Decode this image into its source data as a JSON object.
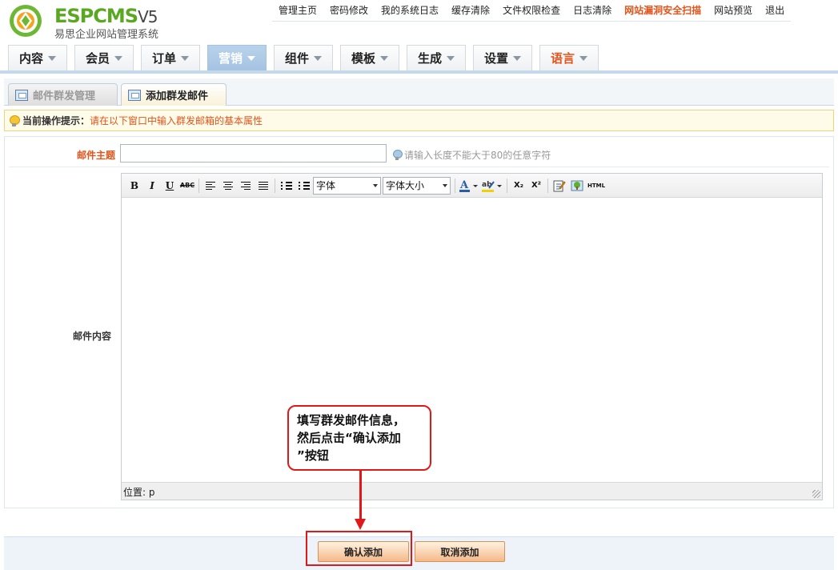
{
  "logo": {
    "brand_espcms": "ESPCMS",
    "brand_version": "V5",
    "subtitle": "易思企业网站管理系统"
  },
  "top_nav": [
    "管理主页",
    "密码修改",
    "我的系统日志",
    "缓存清除",
    "文件权限检查",
    "日志清除",
    "网站漏洞安全扫描",
    "网站预览",
    "退出"
  ],
  "main_menu": [
    {
      "label": "内容"
    },
    {
      "label": "会员"
    },
    {
      "label": "订单"
    },
    {
      "label": "营销"
    },
    {
      "label": "组件"
    },
    {
      "label": "模板"
    },
    {
      "label": "生成"
    },
    {
      "label": "设置"
    },
    {
      "label": "语言"
    }
  ],
  "active_menu": "营销",
  "tabs": [
    {
      "label": "邮件群发管理"
    },
    {
      "label": "添加群发邮件"
    }
  ],
  "hint": {
    "label": "当前操作提示：",
    "text": "请在以下窗口中输入群发邮箱的基本属性"
  },
  "form": {
    "subject_label": "邮件主题",
    "subject_value": "",
    "subject_hint": "请输入长度不能大于80的任意字符",
    "content_label": "邮件内容"
  },
  "editor": {
    "font_select": "字体",
    "size_select": "字体大小",
    "status_label": "位置:",
    "status_value": "p",
    "toolbar_labels": {
      "bold": "B",
      "italic": "I",
      "underline": "U",
      "strike": "ABC",
      "sub": "X₂",
      "sup": "X²",
      "html": "HTML"
    }
  },
  "callout": {
    "text_line1": "填写群发邮件信息，",
    "text_line2": "然后点击“确认添加",
    "text_line3": "”按钮"
  },
  "buttons": {
    "confirm": "确认添加",
    "cancel": "取消添加"
  },
  "colors": {
    "accent_orange": "#e2541b",
    "active_menu_bg": "#a4c3e2",
    "callout_red": "#e01818",
    "brand_green": "#5aa822"
  }
}
